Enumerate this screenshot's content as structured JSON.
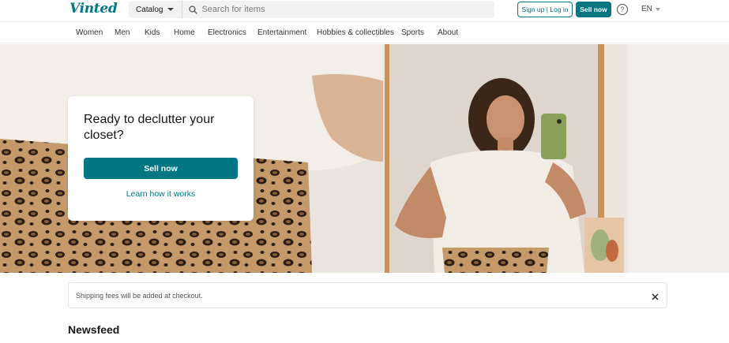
{
  "header": {
    "logo": "Vinted",
    "catalog_label": "Catalog",
    "search_placeholder": "Search for items",
    "signup_label": "Sign up | Log in",
    "sell_label": "Sell now",
    "help_label": "?",
    "language": "EN",
    "brand_color": "#007782"
  },
  "nav": {
    "items": [
      {
        "label": "Women"
      },
      {
        "label": "Men"
      },
      {
        "label": "Kids"
      },
      {
        "label": "Home"
      },
      {
        "label": "Electronics"
      },
      {
        "label": "Entertainment"
      },
      {
        "label": "Hobbies & collectibles"
      },
      {
        "label": "Sports"
      },
      {
        "label": "About"
      }
    ]
  },
  "hero": {
    "title": "Ready to declutter your closet?",
    "sell_button": "Sell now",
    "learn_link": "Learn how it works"
  },
  "notice": {
    "text": "Shipping fees will be added at checkout."
  },
  "main": {
    "section_title": "Newsfeed"
  }
}
